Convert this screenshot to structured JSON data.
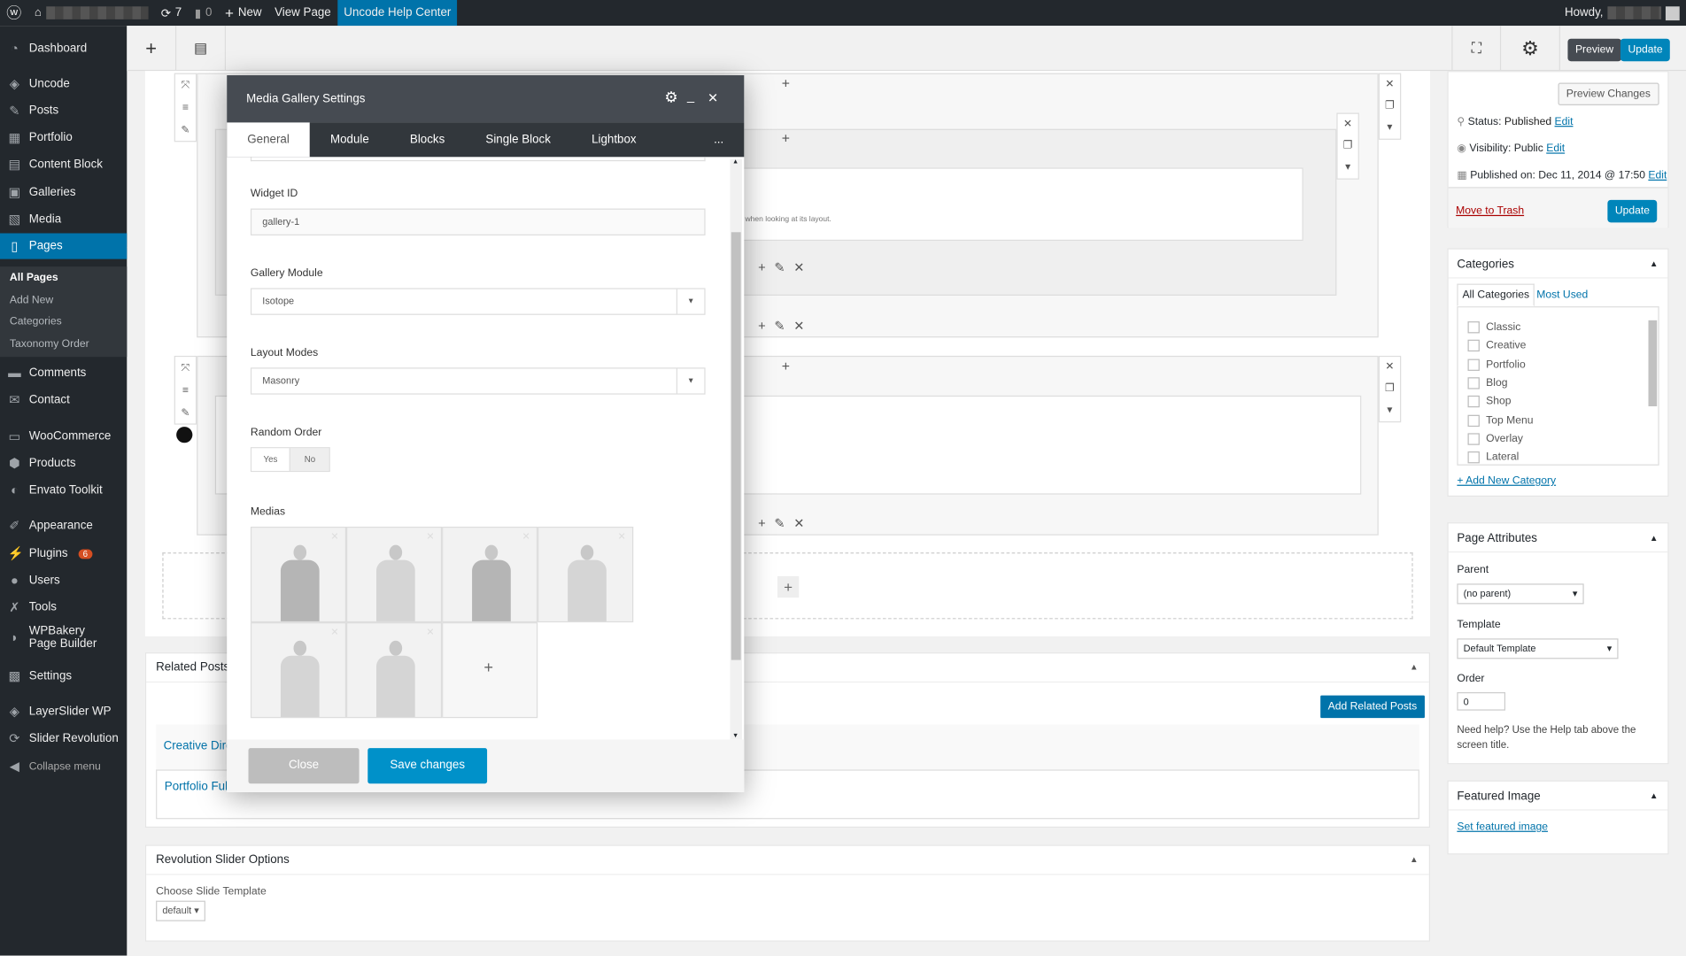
{
  "adminbar": {
    "updates": "7",
    "comments": "0",
    "new": "New",
    "view_page": "View Page",
    "help_center": "Uncode Help Center",
    "howdy": "Howdy,"
  },
  "sidebar": {
    "items": [
      {
        "label": "Dashboard",
        "icon": "dashboard-icon"
      },
      {
        "label": "Uncode",
        "icon": "layers-icon"
      },
      {
        "label": "Posts",
        "icon": "pin-icon"
      },
      {
        "label": "Portfolio",
        "icon": "portfolio-icon"
      },
      {
        "label": "Content Block",
        "icon": "block-icon"
      },
      {
        "label": "Galleries",
        "icon": "gallery-icon"
      },
      {
        "label": "Media",
        "icon": "media-icon"
      },
      {
        "label": "Pages",
        "icon": "pages-icon"
      },
      {
        "label": "Comments",
        "icon": "comment-icon"
      },
      {
        "label": "Contact",
        "icon": "mail-icon"
      },
      {
        "label": "WooCommerce",
        "icon": "woo-icon"
      },
      {
        "label": "Products",
        "icon": "box-icon"
      },
      {
        "label": "Envato Toolkit",
        "icon": "envato-icon"
      },
      {
        "label": "Appearance",
        "icon": "brush-icon"
      },
      {
        "label": "Plugins",
        "icon": "plugin-icon",
        "badge": "6"
      },
      {
        "label": "Users",
        "icon": "user-icon"
      },
      {
        "label": "Tools",
        "icon": "wrench-icon"
      },
      {
        "label": "WPBakery Page Builder",
        "icon": "builder-icon"
      },
      {
        "label": "Settings",
        "icon": "settings-icon"
      },
      {
        "label": "LayerSlider WP",
        "icon": "layers-icon"
      },
      {
        "label": "Slider Revolution",
        "icon": "refresh-icon"
      },
      {
        "label": "Collapse menu",
        "icon": "collapse-icon"
      }
    ],
    "submenu": [
      "All Pages",
      "Add New",
      "Categories",
      "Taxonomy Order"
    ]
  },
  "toolbar": {
    "preview": "Preview",
    "update": "Update"
  },
  "builder": {
    "text_fragment": "when looking at its layout."
  },
  "modal": {
    "title": "Media Gallery Settings",
    "tabs": [
      "General",
      "Module",
      "Blocks",
      "Single Block",
      "Lightbox"
    ],
    "more": "...",
    "widget_id_label": "Widget ID",
    "widget_id_value": "gallery-1",
    "gallery_module_label": "Gallery Module",
    "gallery_module_value": "Isotope",
    "layout_modes_label": "Layout Modes",
    "layout_modes_value": "Masonry",
    "random_order_label": "Random Order",
    "random_yes": "Yes",
    "random_no": "No",
    "random_selected": "No",
    "medias_label": "Medias",
    "media_count": 6,
    "close": "Close",
    "save": "Save changes"
  },
  "related": {
    "title": "Related Posts",
    "add": "Add Related Posts",
    "items": [
      "Creative Dire",
      "Portfolio Ful"
    ]
  },
  "revslider": {
    "title": "Revolution Slider Options",
    "choose_label": "Choose Slide Template",
    "choose_value": "default"
  },
  "publish": {
    "preview_changes": "Preview Changes",
    "status_label": "Status:",
    "status": "Published",
    "visibility_label": "Visibility:",
    "visibility": "Public",
    "published_label": "Published on:",
    "published": "Dec 11, 2014 @ 17:50",
    "edit": "Edit",
    "trash": "Move to Trash",
    "update": "Update"
  },
  "categories": {
    "title": "Categories",
    "tab_all": "All Categories",
    "tab_most": "Most Used",
    "items": [
      "Classic",
      "Creative",
      "Portfolio",
      "Blog",
      "Shop",
      "Top Menu",
      "Overlay",
      "Lateral"
    ],
    "add_new": "+ Add New Category"
  },
  "attributes": {
    "title": "Page Attributes",
    "parent_label": "Parent",
    "parent_value": "(no parent)",
    "template_label": "Template",
    "template_value": "Default Template",
    "order_label": "Order",
    "order_value": "0",
    "help": "Need help? Use the Help tab above the screen title."
  },
  "featured": {
    "title": "Featured Image",
    "set": "Set featured image"
  }
}
